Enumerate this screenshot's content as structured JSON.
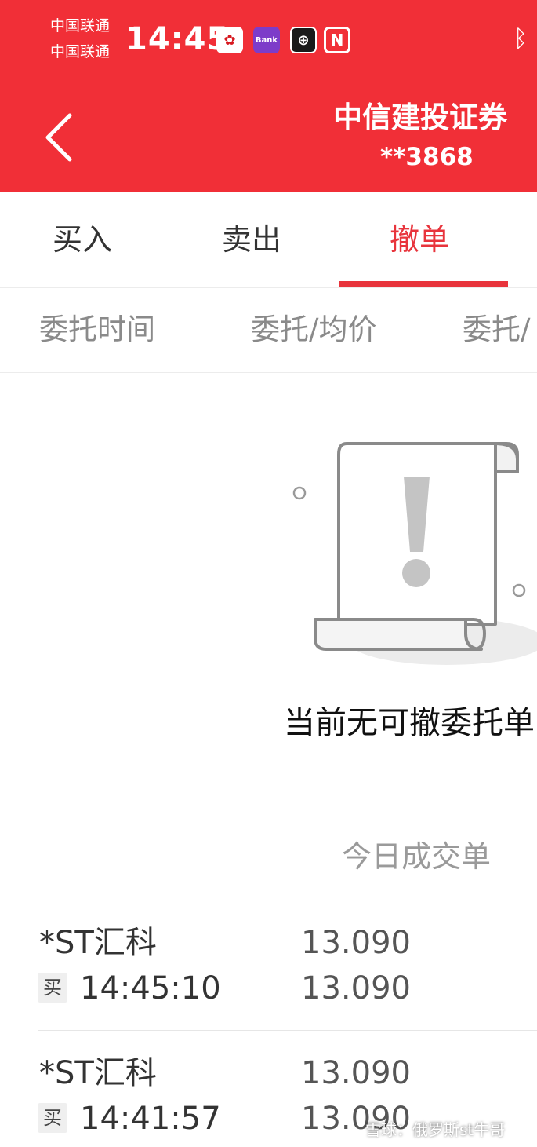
{
  "status_bar": {
    "carrier_1": "中国联通",
    "carrier_2": "中国联通",
    "time": "14:45",
    "bank_icon_label": "Bank",
    "icons": [
      "huawei-app-icon",
      "ebank-app-icon",
      "boc-app-icon",
      "nfc-icon",
      "bluetooth-icon"
    ]
  },
  "header": {
    "broker": "中信建投证券",
    "account": "**3868",
    "accent_color": "#f12f37"
  },
  "tabs": [
    {
      "label": "买入",
      "active": false
    },
    {
      "label": "卖出",
      "active": false
    },
    {
      "label": "撤单",
      "active": true
    }
  ],
  "columns": [
    "委托时间",
    "委托/均价",
    "委托/"
  ],
  "empty_state": {
    "message": "当前无可撤委托单"
  },
  "today_link": "今日成交单",
  "trades": [
    {
      "side": "买",
      "name": "*ST汇科",
      "time": "14:45:10",
      "price": "13.090",
      "avg_price": "13.090"
    },
    {
      "side": "买",
      "name": "*ST汇科",
      "time": "14:41:57",
      "price": "13.090",
      "avg_price": "13.090"
    }
  ],
  "watermark": "雪球：俄罗斯st牛哥"
}
